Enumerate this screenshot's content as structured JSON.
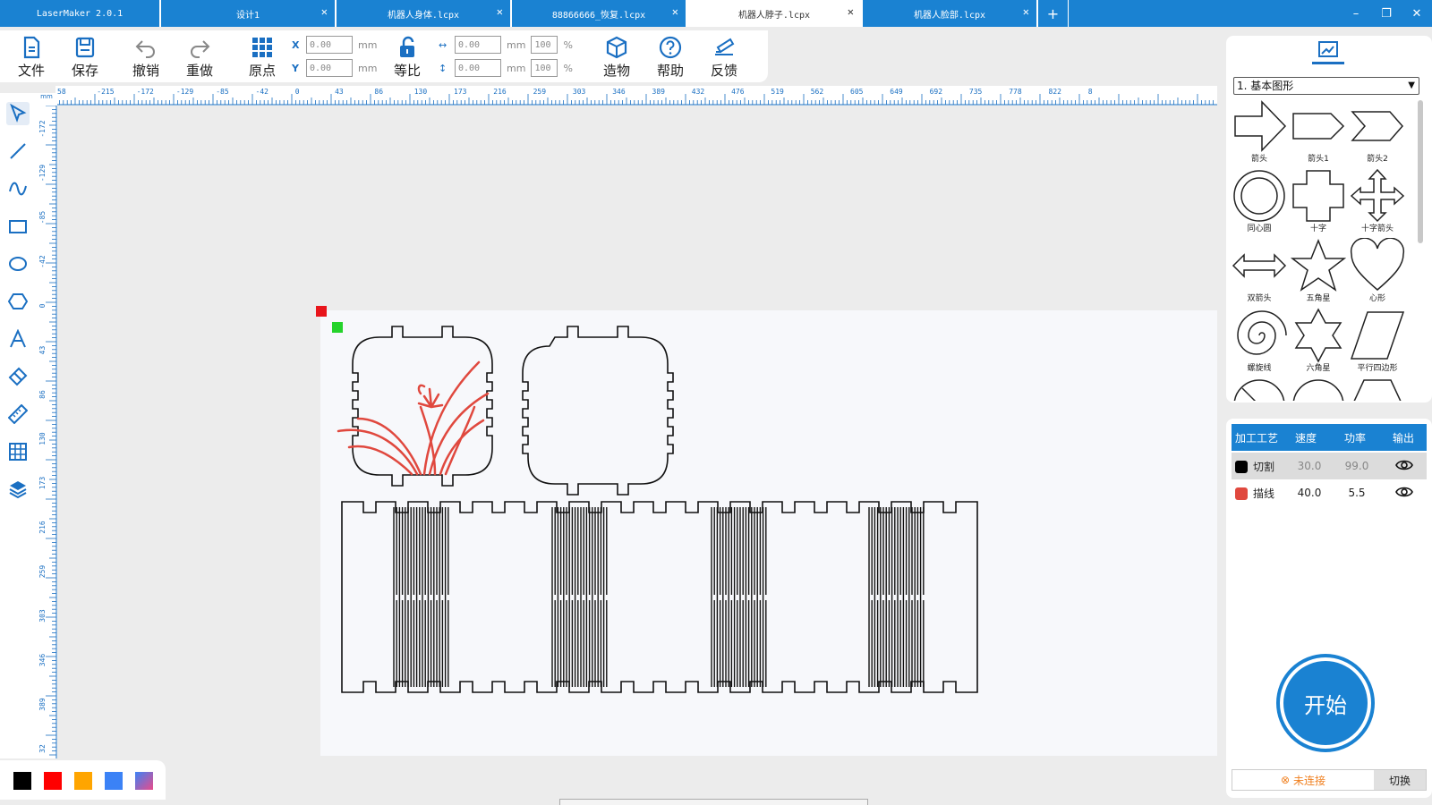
{
  "tabs": [
    {
      "label": "LaserMaker 2.0.1",
      "closable": false,
      "active": false
    },
    {
      "label": "设计1",
      "closable": true,
      "active": false
    },
    {
      "label": "机器人身体.lcpx",
      "closable": true,
      "active": false
    },
    {
      "label": "88866666_恢复.lcpx",
      "closable": true,
      "active": false
    },
    {
      "label": "机器人脖子.lcpx",
      "closable": true,
      "active": true
    },
    {
      "label": "机器人脸部.lcpx",
      "closable": true,
      "active": false
    }
  ],
  "tab_add": "+",
  "window": {
    "minimize": "–",
    "restore": "❐",
    "close": "✕"
  },
  "toolbar": {
    "file": "文件",
    "save": "保存",
    "undo": "撤销",
    "redo": "重做",
    "origin": "原点",
    "equal_ratio": "等比",
    "build": "造物",
    "help": "帮助",
    "feedback": "反馈",
    "x_label": "X",
    "y_label": "Y",
    "x_value": "0.00",
    "y_value": "0.00",
    "w_value": "0.00",
    "h_value": "0.00",
    "w_pct": "100",
    "h_pct": "100",
    "unit": "mm",
    "pct_unit": "%"
  },
  "ruler": {
    "corner": "mm",
    "top_labels": [
      "58",
      "-215",
      "-172",
      "-129",
      "-85",
      "-42",
      "0",
      "43",
      "86",
      "130",
      "173",
      "216",
      "259",
      "303",
      "346",
      "389",
      "432",
      "476",
      "519",
      "562",
      "605",
      "649",
      "692",
      "735",
      "778",
      "822",
      "8"
    ],
    "left_labels": [
      "-172",
      "-129",
      "-85",
      "-42",
      "0",
      "43",
      "86",
      "130",
      "173",
      "216",
      "259",
      "303",
      "346",
      "389",
      "32"
    ]
  },
  "left_tools": [
    "select-tool",
    "line-tool",
    "curve-tool",
    "rectangle-tool",
    "ellipse-tool",
    "polygon-tool",
    "text-tool",
    "eraser-tool",
    "measure-tool",
    "array-tool",
    "layers-tool"
  ],
  "colors": {
    "accent": "#1a82d2",
    "swatches": [
      "#000000",
      "#ff0000",
      "#ffa500",
      "#3b82f6",
      "gradient"
    ],
    "plant": "#e0483e"
  },
  "shapes_panel": {
    "category": "1. 基本图形",
    "items": [
      "箭头",
      "箭头1",
      "箭头2",
      "同心圆",
      "十字",
      "十字箭头",
      "双箭头",
      "五角星",
      "心形",
      "螺旋线",
      "六角星",
      "平行四边形"
    ]
  },
  "process_panel": {
    "headers": [
      "加工工艺",
      "速度",
      "功率",
      "输出"
    ],
    "rows": [
      {
        "name": "切割",
        "speed": "30.0",
        "power": "99.0",
        "color": "#000000"
      },
      {
        "name": "描线",
        "speed": "40.0",
        "power": "5.5",
        "color": "#e0483e"
      }
    ],
    "start": "开始",
    "connection": "未连接",
    "switch": "切换"
  }
}
